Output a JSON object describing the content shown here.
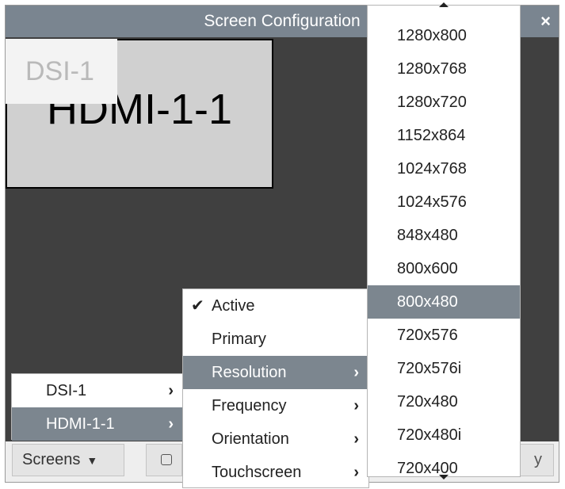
{
  "window": {
    "title": "Screen Configuration",
    "close_icon": "close-icon",
    "close_glyph": "×"
  },
  "monitors": {
    "dsi": {
      "label": "DSI-1"
    },
    "hdmi": {
      "label": "HDMI-1-1"
    }
  },
  "bottom": {
    "screens_label": "Screens",
    "screens_caret": "▼",
    "apply_partial": "y"
  },
  "screens_menu": {
    "items": [
      {
        "label": "DSI-1",
        "arrow": "›"
      },
      {
        "label": "HDMI-1-1",
        "arrow": "›"
      }
    ],
    "selected": "HDMI-1-1"
  },
  "sub_menu": {
    "items": [
      {
        "label": "Active",
        "check": "✔",
        "checked": true
      },
      {
        "label": "Primary"
      },
      {
        "label": "Resolution",
        "arrow": "›"
      },
      {
        "label": "Frequency",
        "arrow": "›"
      },
      {
        "label": "Orientation",
        "arrow": "›"
      },
      {
        "label": "Touchscreen",
        "arrow": "›"
      }
    ],
    "selected": "Resolution"
  },
  "resolution_menu": {
    "items": [
      "1280x800",
      "1280x768",
      "1280x720",
      "1152x864",
      "1024x768",
      "1024x576",
      "848x480",
      "800x600",
      "800x480",
      "720x576",
      "720x576i",
      "720x480",
      "720x480i",
      "720x400"
    ],
    "selected": "800x480"
  },
  "colors": {
    "titlebar": "#7a8590",
    "canvas": "#404040",
    "highlight": "#7c868f"
  }
}
